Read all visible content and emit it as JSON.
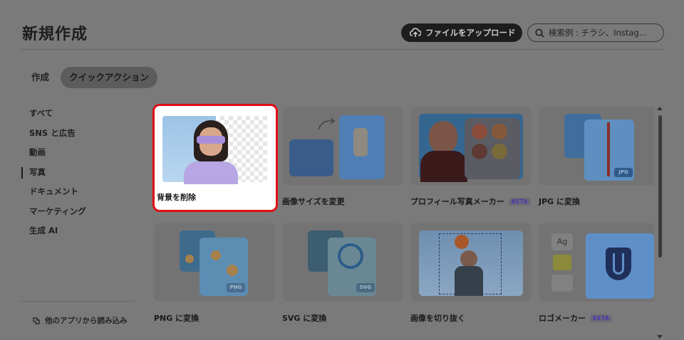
{
  "header": {
    "title": "新規作成",
    "upload_label": "ファイルをアップロード",
    "search_placeholder": "検索例 : チラシ、Instag…"
  },
  "tabs": [
    {
      "label": "作成",
      "active": false
    },
    {
      "label": "クイックアクション",
      "active": true
    }
  ],
  "sidebar": {
    "items": [
      {
        "label": "すべて",
        "active": false
      },
      {
        "label": "SNS と広告",
        "active": false
      },
      {
        "label": "動画",
        "active": false
      },
      {
        "label": "写真",
        "active": true
      },
      {
        "label": "ドキュメント",
        "active": false
      },
      {
        "label": "マーケティング",
        "active": false
      },
      {
        "label": "生成 AI",
        "active": false
      }
    ],
    "other_apps": "他のアプリから読み込み"
  },
  "cards": [
    {
      "label": "背景を削除",
      "beta": false,
      "highlighted": true
    },
    {
      "label": "画像サイズを変更",
      "beta": false
    },
    {
      "label": "プロフィール写真メーカー",
      "beta": true
    },
    {
      "label": "JPG に変換",
      "beta": false,
      "badge": "JPG"
    },
    {
      "label": "PNG に変換",
      "beta": false,
      "badge": "PNG"
    },
    {
      "label": "SVG に変換",
      "beta": false,
      "badge": "SVG"
    },
    {
      "label": "画像を切り抜く",
      "beta": false
    },
    {
      "label": "ロゴメーカー",
      "beta": true,
      "badge": "Ag"
    }
  ],
  "beta_label": "BETA",
  "colors": {
    "highlight_border": "#e00f16",
    "overlay": "#7a7a7a"
  }
}
